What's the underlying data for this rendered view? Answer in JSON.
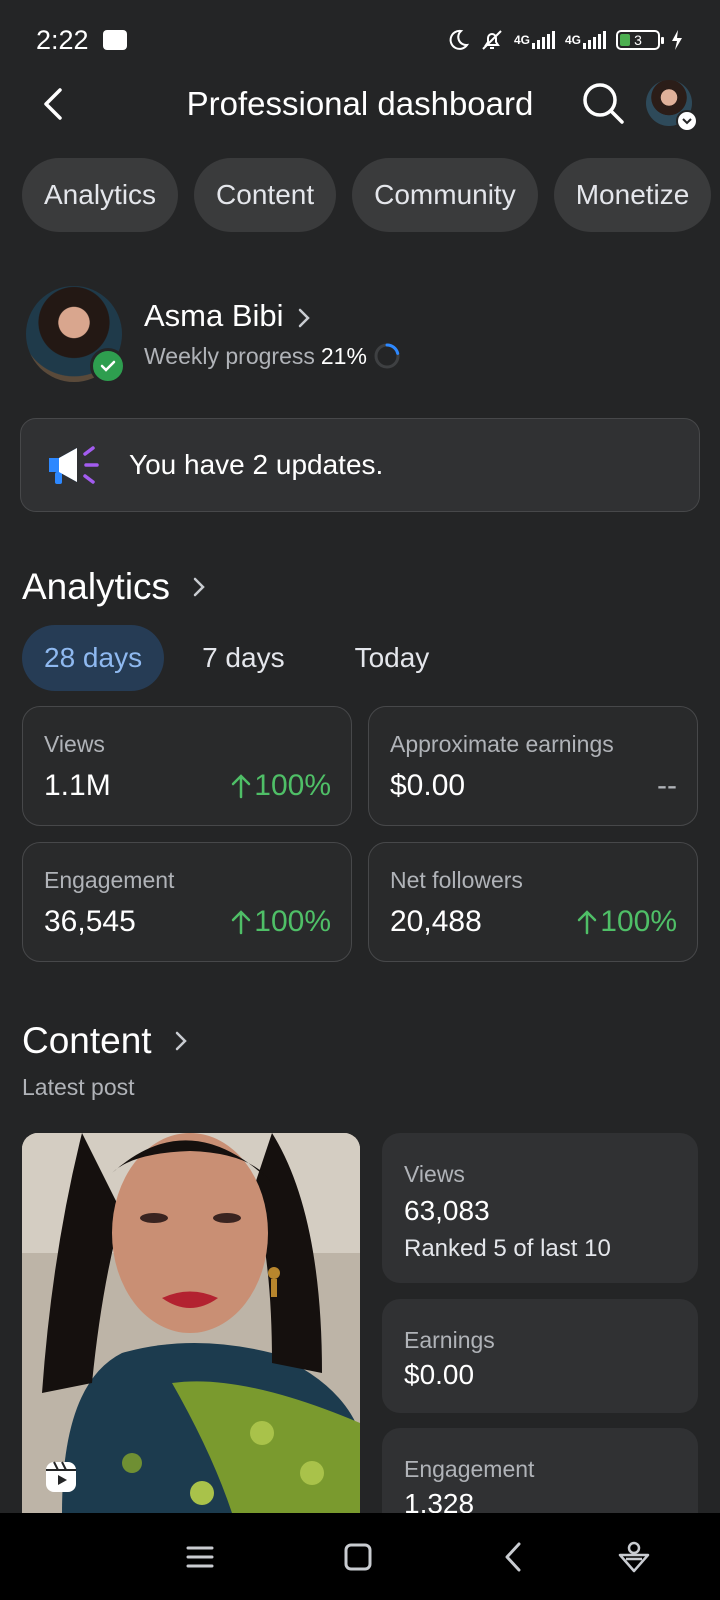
{
  "status_bar": {
    "time": "2:22",
    "network_1": "4G",
    "network_2": "4G",
    "battery_level": "3"
  },
  "header": {
    "title": "Professional dashboard"
  },
  "tabs": [
    {
      "label": "Analytics"
    },
    {
      "label": "Content"
    },
    {
      "label": "Community"
    },
    {
      "label": "Monetize"
    }
  ],
  "profile": {
    "name": "Asma Bibi",
    "progress_label": "Weekly progress",
    "progress_value": "21%",
    "progress_fraction": 0.21
  },
  "updates": {
    "text": "You have 2 updates."
  },
  "analytics": {
    "title": "Analytics",
    "ranges": [
      {
        "label": "28 days",
        "active": true
      },
      {
        "label": "7 days",
        "active": false
      },
      {
        "label": "Today",
        "active": false
      }
    ],
    "stats": [
      {
        "label": "Views",
        "value": "1.1M",
        "change": "100%",
        "trend": "up"
      },
      {
        "label": "Approximate earnings",
        "value": "$0.00",
        "change": "--",
        "trend": "none"
      },
      {
        "label": "Engagement",
        "value": "36,545",
        "change": "100%",
        "trend": "up"
      },
      {
        "label": "Net followers",
        "value": "20,488",
        "change": "100%",
        "trend": "up"
      }
    ]
  },
  "content": {
    "title": "Content",
    "subtitle": "Latest post",
    "cards": [
      {
        "label": "Views",
        "value": "63,083",
        "extra": "Ranked 5 of last 10"
      },
      {
        "label": "Earnings",
        "value": "$0.00"
      },
      {
        "label": "Engagement",
        "value": "1,328"
      }
    ]
  },
  "colors": {
    "background": "#242526",
    "accent_blue": "#8fb9f0",
    "positive_green": "#4fbf67"
  }
}
